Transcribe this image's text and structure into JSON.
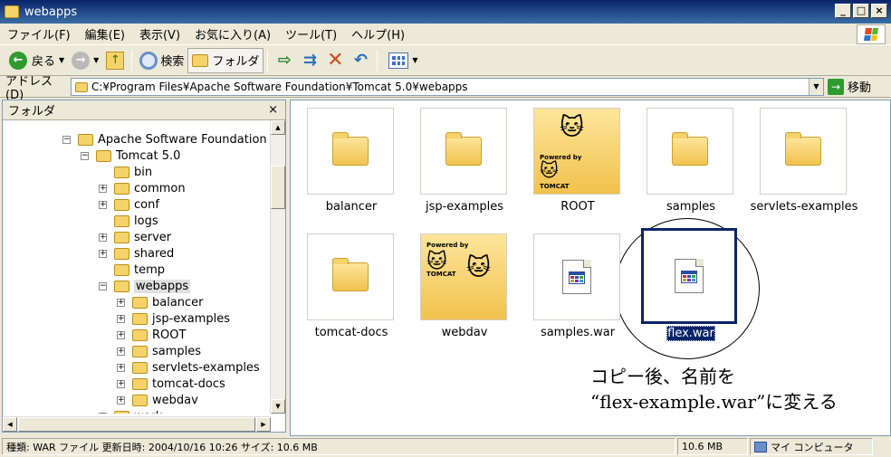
{
  "window": {
    "title": "webapps"
  },
  "menu": [
    "ファイル(F)",
    "編集(E)",
    "表示(V)",
    "お気に入り(A)",
    "ツール(T)",
    "ヘルプ(H)"
  ],
  "toolbar": {
    "back_label": "戻る",
    "search_label": "検索",
    "folders_label": "フォルダ"
  },
  "address": {
    "label": "アドレス(D)",
    "path": "C:¥Program Files¥Apache Software Foundation¥Tomcat 5.0¥webapps",
    "go_label": "移動"
  },
  "folder_pane": {
    "title": "フォルダ",
    "close": "×",
    "tree": [
      {
        "label": "Apache Software Foundation",
        "level": 0,
        "exp": "−"
      },
      {
        "label": "Tomcat 5.0",
        "level": 1,
        "exp": "−"
      },
      {
        "label": "bin",
        "level": 2,
        "exp": ""
      },
      {
        "label": "common",
        "level": 2,
        "exp": "+"
      },
      {
        "label": "conf",
        "level": 2,
        "exp": "+"
      },
      {
        "label": "logs",
        "level": 2,
        "exp": ""
      },
      {
        "label": "server",
        "level": 2,
        "exp": "+"
      },
      {
        "label": "shared",
        "level": 2,
        "exp": "+"
      },
      {
        "label": "temp",
        "level": 2,
        "exp": ""
      },
      {
        "label": "webapps",
        "level": 2,
        "exp": "−",
        "selected": true
      },
      {
        "label": "balancer",
        "level": 3,
        "exp": "+"
      },
      {
        "label": "jsp-examples",
        "level": 3,
        "exp": "+"
      },
      {
        "label": "ROOT",
        "level": 3,
        "exp": "+"
      },
      {
        "label": "samples",
        "level": 3,
        "exp": "+"
      },
      {
        "label": "servlets-examples",
        "level": 3,
        "exp": "+"
      },
      {
        "label": "tomcat-docs",
        "level": 3,
        "exp": "+"
      },
      {
        "label": "webdav",
        "level": 3,
        "exp": "+"
      },
      {
        "label": "work",
        "level": 2,
        "exp": "+"
      }
    ]
  },
  "items": [
    {
      "name": "balancer",
      "kind": "folder"
    },
    {
      "name": "jsp-examples",
      "kind": "folder"
    },
    {
      "name": "ROOT",
      "kind": "tomcat-folder"
    },
    {
      "name": "samples",
      "kind": "folder"
    },
    {
      "name": "servlets-examples",
      "kind": "folder"
    },
    {
      "name": "tomcat-docs",
      "kind": "folder"
    },
    {
      "name": "webdav",
      "kind": "tomcat-folder"
    },
    {
      "name": "samples.war",
      "kind": "war"
    },
    {
      "name": "flex.war",
      "kind": "war",
      "selected": true
    }
  ],
  "tomcat_badge": {
    "powered": "Powered by",
    "brand": "TOMCAT"
  },
  "annotation": {
    "line1": "コピー後、名前を",
    "line2": "“flex-example.war”に変える"
  },
  "status": {
    "info": "種類: WAR ファイル 更新日時: 2004/10/16 10:26 サイズ: 10.6 MB",
    "size": "10.6 MB",
    "location": "マイ コンピュータ"
  },
  "colors": {
    "title_bar": "#0a246a",
    "selection": "#0a246a",
    "folder": "#f5d36a"
  }
}
